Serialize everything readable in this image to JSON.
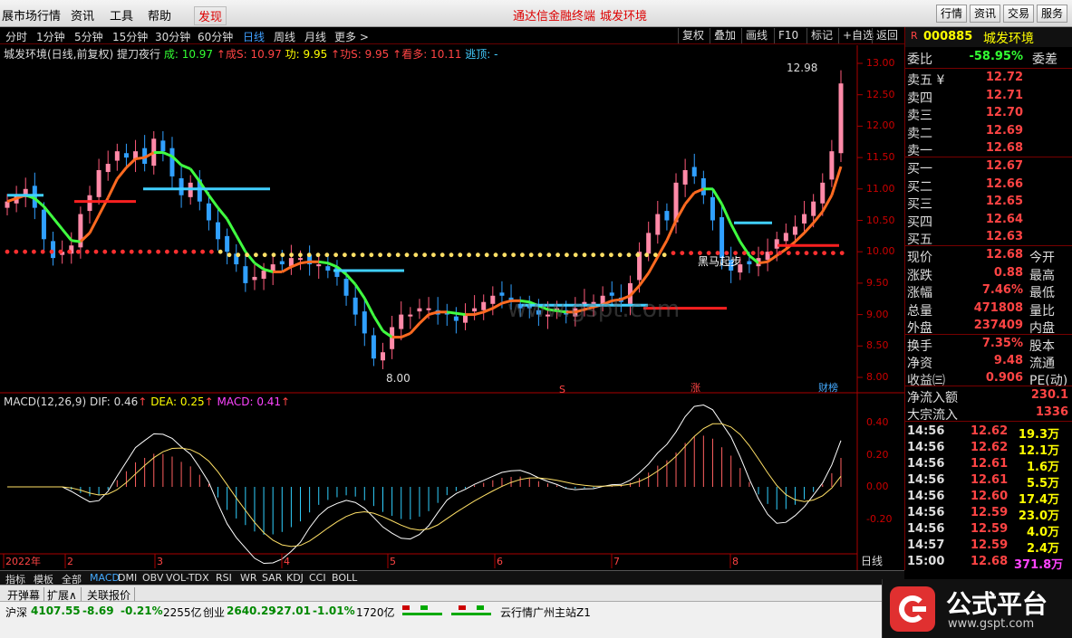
{
  "menu": {
    "items": [
      "展市场行情",
      "资讯",
      "工具",
      "帮助"
    ],
    "discover": "发现",
    "center_title": "通达信金融终端",
    "stock_title": "城发环境",
    "right_buttons": [
      "行情",
      "资讯",
      "交易",
      "服务"
    ]
  },
  "timeframes": [
    "分时",
    "1分钟",
    "5分钟",
    "15分钟",
    "30分钟",
    "60分钟",
    "日线",
    "周线",
    "月线",
    "更多 >"
  ],
  "active_timeframe": "日线",
  "toolbar_right": [
    "复权",
    "叠加",
    "画线",
    "F10",
    "标记",
    "+自选",
    "返回"
  ],
  "title_line": {
    "name": "城发环境(日线,前复权)",
    "indicator": "提刀夜行",
    "cheng": "成: 10.97",
    "chengS": "成S: 10.97",
    "gong": "功: 9.95",
    "gongS": "功S: 9.95",
    "kanduo": "看多: 10.11",
    "taoding": "逃顶: -"
  },
  "annotations": {
    "high": "12.98",
    "low": "8.00",
    "heima": "黑马起步",
    "s_mark": "S",
    "zhang": "涨",
    "caibang": "财榜"
  },
  "watermark": "www.gspt.com",
  "macd_line": {
    "name": "MACD(12,26,9)",
    "dif": "DIF: 0.46",
    "dea": "DEA: 0.25",
    "macd": "MACD: 0.41"
  },
  "price_axis": [
    "13.00",
    "12.50",
    "12.00",
    "11.50",
    "11.00",
    "10.50",
    "10.00",
    "9.50",
    "9.00",
    "8.50",
    "8.00"
  ],
  "macd_axis": [
    "0.40",
    "0.20",
    "0.00",
    "-0.20"
  ],
  "date_labels": [
    "2022年",
    "2",
    "3",
    "4",
    "5",
    "6",
    "7",
    "8"
  ],
  "period_label": "日线",
  "panel": {
    "code": "000885",
    "name": "城发环境",
    "weibi_label": "委比",
    "weibi": "-58.95%",
    "weicha_label": "委差",
    "asks": [
      {
        "label": "卖五 ¥",
        "price": "12.72"
      },
      {
        "label": "卖四",
        "price": "12.71"
      },
      {
        "label": "卖三",
        "price": "12.70"
      },
      {
        "label": "卖二",
        "price": "12.69"
      },
      {
        "label": "卖一",
        "price": "12.68"
      }
    ],
    "bids": [
      {
        "label": "买一",
        "price": "12.67"
      },
      {
        "label": "买二",
        "price": "12.66"
      },
      {
        "label": "买三",
        "price": "12.65"
      },
      {
        "label": "买四",
        "price": "12.64"
      },
      {
        "label": "买五",
        "price": "12.63"
      }
    ],
    "stats": [
      {
        "label": "现价",
        "value": "12.68",
        "label2": "今开"
      },
      {
        "label": "涨跌",
        "value": "0.88",
        "label2": "最高"
      },
      {
        "label": "涨幅",
        "value": "7.46%",
        "label2": "最低"
      },
      {
        "label": "总量",
        "value": "471808",
        "label2": "量比"
      },
      {
        "label": "外盘",
        "value": "237409",
        "label2": "内盘"
      }
    ],
    "stats2": [
      {
        "label": "换手",
        "value": "7.35%",
        "label2": "股本"
      },
      {
        "label": "净资",
        "value": "9.48",
        "label2": "流通"
      },
      {
        "label": "收益㈢",
        "value": "0.906",
        "label2": "PE(动)"
      }
    ],
    "flows": [
      {
        "label": "净流入额",
        "value": "230.1"
      },
      {
        "label": "大宗流入",
        "value": "1336"
      }
    ],
    "ticks": [
      {
        "time": "14:56",
        "price": "12.62",
        "vol": "19.3万"
      },
      {
        "time": "14:56",
        "price": "12.62",
        "vol": "12.1万"
      },
      {
        "time": "14:56",
        "price": "12.61",
        "vol": "1.6万"
      },
      {
        "time": "14:56",
        "price": "12.61",
        "vol": "5.5万"
      },
      {
        "time": "14:56",
        "price": "12.60",
        "vol": "17.4万"
      },
      {
        "time": "14:56",
        "price": "12.59",
        "vol": "23.0万"
      },
      {
        "time": "14:56",
        "price": "12.59",
        "vol": "4.0万"
      },
      {
        "time": "14:57",
        "price": "12.59",
        "vol": "2.4万"
      },
      {
        "time": "15:00",
        "price": "12.68",
        "vol": "371.8万"
      }
    ]
  },
  "bottom_tabs": [
    "指标",
    "模板",
    "全部",
    "MACD",
    "DMI",
    "OBV",
    "VOL-TDX",
    "RSI",
    "WR",
    "SAR",
    "KDJ",
    "CCI",
    "BOLL"
  ],
  "active_bottom_tab": "MACD",
  "tool_row": [
    "开弹幕",
    "扩展∧",
    "关联报价"
  ],
  "status": {
    "sh_label": "沪深",
    "sh_value": "4107.55",
    "sh_change": "-8.69",
    "sh_pct": "-0.21%",
    "sh_amount": "2255亿",
    "cy_label": "创业",
    "cy_value": "2640.29",
    "cy_change": "-27.01",
    "cy_pct": "-1.01%",
    "cy_amount": "1720亿",
    "server": "云行情广州主站Z1"
  },
  "logo": {
    "title": "公式平台",
    "url": "www.gspt.com"
  },
  "chart_data": {
    "type": "candlestick",
    "closes": [
      10.8,
      10.9,
      11.0,
      10.7,
      10.2,
      9.9,
      10.0,
      10.1,
      10.6,
      10.9,
      11.3,
      11.4,
      11.6,
      11.5,
      11.6,
      11.4,
      11.8,
      11.6,
      11.2,
      10.9,
      11.1,
      10.8,
      10.5,
      10.2,
      10.0,
      9.8,
      9.5,
      9.6,
      9.7,
      9.8,
      9.8,
      9.9,
      9.9,
      9.8,
      9.8,
      9.7,
      9.6,
      9.3,
      9.0,
      8.7,
      8.3,
      8.4,
      8.8,
      9.0,
      9.0,
      9.1,
      9.1,
      9.0,
      9.0,
      8.9,
      9.0,
      9.1,
      9.2,
      9.3,
      9.3,
      9.2,
      9.1,
      9.1,
      9.0,
      9.0,
      9.1,
      9.0,
      9.1,
      9.2,
      9.2,
      9.3,
      9.3,
      9.2,
      9.5,
      10.0,
      10.3,
      10.6,
      10.5,
      11.1,
      11.3,
      11.2,
      10.9,
      10.5,
      9.9,
      9.7,
      9.8,
      9.8,
      9.9,
      10.0,
      10.2,
      10.3,
      10.4,
      10.6,
      10.8,
      11.1,
      11.6,
      12.68
    ],
    "ylim": [
      8.0,
      13.0
    ],
    "macd_ylim": [
      -0.3,
      0.5
    ]
  }
}
